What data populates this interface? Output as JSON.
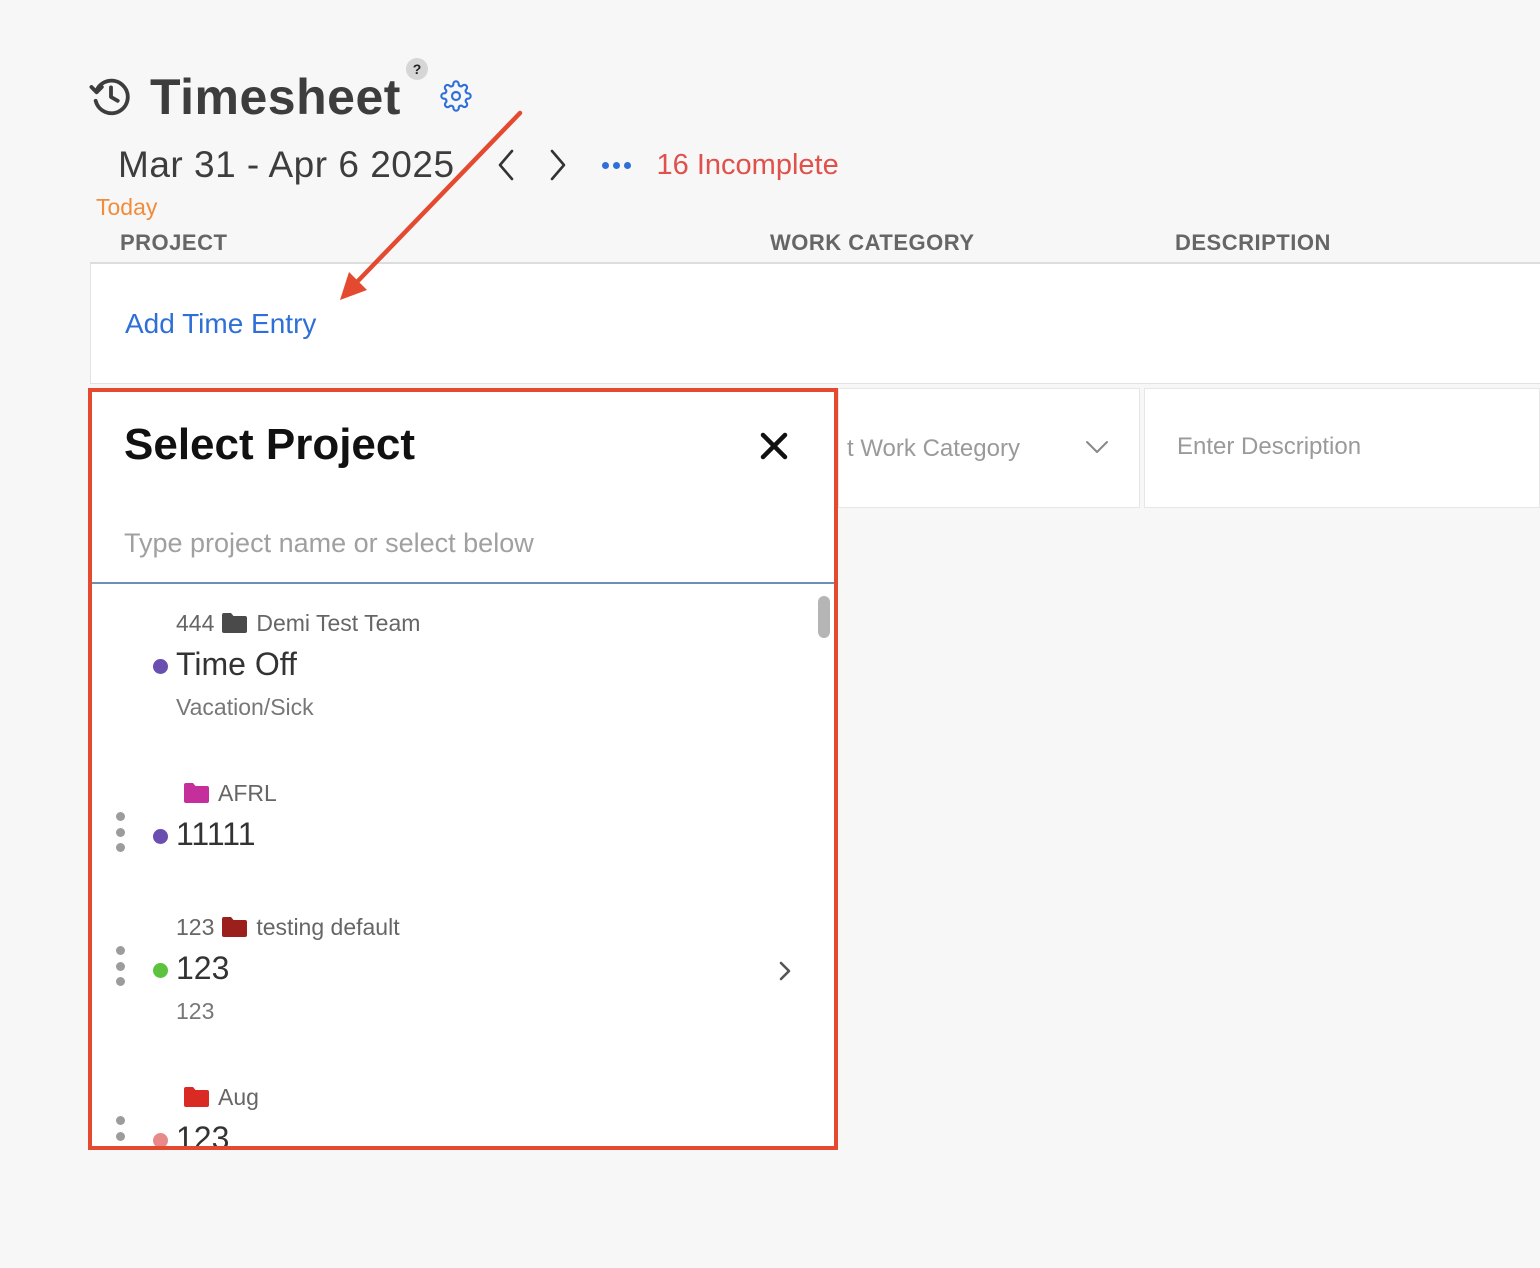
{
  "header": {
    "title": "Timesheet",
    "help": "?",
    "icons": {
      "history": "history-icon",
      "settings": "gear-icon"
    }
  },
  "week": {
    "range": "Mar 31 - Apr 6 2025",
    "incomplete": "16 Incomplete",
    "today": "Today"
  },
  "columns": {
    "project": "PROJECT",
    "work_category": "WORK CATEGORY",
    "description": "DESCRIPTION"
  },
  "add_entry": "Add Time Entry",
  "entry_row": {
    "work_category_placeholder": "t Work Category",
    "description_placeholder": "Enter Description"
  },
  "picker": {
    "title": "Select Project",
    "search_placeholder": "Type project name or select below",
    "items": [
      {
        "code": "444",
        "team": "Demi Test Team",
        "folder_color": "#4a4a4a",
        "dot_color": "#6a4fb0",
        "name": "Time Off",
        "subtitle": "Vacation/Sick",
        "draggable": false,
        "has_children": false
      },
      {
        "code": "",
        "team": "AFRL",
        "folder_color": "#c52f9c",
        "dot_color": "#6a4fb0",
        "name": "11111",
        "subtitle": "",
        "draggable": true,
        "has_children": false
      },
      {
        "code": "123",
        "team": "testing default",
        "folder_color": "#9b1f1b",
        "dot_color": "#5cc33c",
        "name": "123",
        "subtitle": "123",
        "draggable": true,
        "has_children": true
      },
      {
        "code": "",
        "team": "Aug",
        "folder_color": "#d92b24",
        "dot_color": "#e88a8a",
        "name": "123",
        "subtitle": "",
        "draggable": true,
        "has_children": false
      }
    ]
  },
  "colors": {
    "accent_blue": "#2f6fd8",
    "incomplete_red": "#e0514b",
    "today_orange": "#f08c3a",
    "highlight_red": "#e34a30"
  }
}
